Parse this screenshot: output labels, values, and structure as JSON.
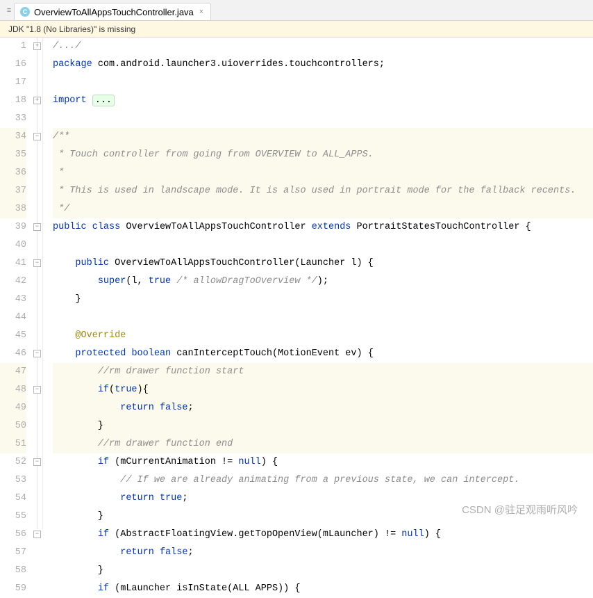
{
  "tab": {
    "icon_letter": "C",
    "filename": "OverviewToAllAppsTouchController.java"
  },
  "notification": {
    "message": "JDK \"1.8 (No Libraries)\" is missing"
  },
  "lines": [
    {
      "n": "1",
      "hl": false,
      "fold": "plus",
      "html": "<span class='cm'>/.../</span>"
    },
    {
      "n": "16",
      "hl": false,
      "fold": "",
      "html": "<span class='kw'>package</span> com.android.launcher3.uioverrides.touchcontrollers;"
    },
    {
      "n": "17",
      "hl": false,
      "fold": "",
      "html": ""
    },
    {
      "n": "18",
      "hl": false,
      "fold": "plus",
      "html": "<span class='kw'>import</span> <span class='folded'>...</span>"
    },
    {
      "n": "33",
      "hl": false,
      "fold": "",
      "html": ""
    },
    {
      "n": "34",
      "hl": true,
      "fold": "minus",
      "html": "<span class='cm'>/**</span>"
    },
    {
      "n": "35",
      "hl": true,
      "fold": "",
      "html": "<span class='cm'> * Touch controller from going from OVERVIEW to ALL_APPS.</span>"
    },
    {
      "n": "36",
      "hl": true,
      "fold": "",
      "html": "<span class='cm'> *</span>"
    },
    {
      "n": "37",
      "hl": true,
      "fold": "",
      "html": "<span class='cm'> * This is used in landscape mode. It is also used in portrait mode for the fallback recents.</span>"
    },
    {
      "n": "38",
      "hl": true,
      "fold": "end",
      "html": "<span class='cm'> */</span>"
    },
    {
      "n": "39",
      "hl": false,
      "fold": "minus",
      "html": "<span class='kw'>public</span> <span class='kw'>class</span> OverviewToAllAppsTouchController <span class='kw'>extends</span> PortraitStatesTouchController {"
    },
    {
      "n": "40",
      "hl": false,
      "fold": "",
      "html": ""
    },
    {
      "n": "41",
      "hl": false,
      "fold": "minus",
      "html": "    <span class='kw'>public</span> OverviewToAllAppsTouchController(Launcher l) {"
    },
    {
      "n": "42",
      "hl": false,
      "fold": "",
      "html": "        <span class='kw'>super</span>(l, <span class='kw'>true</span> <span class='cm'>/* allowDragToOverview */</span>);"
    },
    {
      "n": "43",
      "hl": false,
      "fold": "end",
      "html": "    }"
    },
    {
      "n": "44",
      "hl": false,
      "fold": "",
      "html": ""
    },
    {
      "n": "45",
      "hl": false,
      "fold": "",
      "html": "    <span class='ann'>@Override</span>"
    },
    {
      "n": "46",
      "hl": false,
      "fold": "minus",
      "html": "    <span class='kw'>protected</span> <span class='kw'>boolean</span> canInterceptTouch(MotionEvent ev) {"
    },
    {
      "n": "47",
      "hl": true,
      "fold": "",
      "html": "        <span class='cm'>//rm drawer function start</span>"
    },
    {
      "n": "48",
      "hl": true,
      "fold": "minus",
      "html": "        <span class='kw'>if</span>(<span class='kw'>true</span>){"
    },
    {
      "n": "49",
      "hl": true,
      "fold": "",
      "html": "            <span class='kw'>return</span> <span class='kw'>false</span>;"
    },
    {
      "n": "50",
      "hl": true,
      "fold": "end",
      "html": "        }"
    },
    {
      "n": "51",
      "hl": true,
      "fold": "",
      "html": "        <span class='cm'>//rm drawer function end</span>"
    },
    {
      "n": "52",
      "hl": false,
      "fold": "minus",
      "html": "        <span class='kw'>if</span> (mCurrentAnimation != <span class='kw'>null</span>) {"
    },
    {
      "n": "53",
      "hl": false,
      "fold": "",
      "html": "            <span class='cm'>// If we are already animating from a previous state, we can intercept.</span>"
    },
    {
      "n": "54",
      "hl": false,
      "fold": "",
      "html": "            <span class='kw'>return</span> <span class='kw'>true</span>;"
    },
    {
      "n": "55",
      "hl": false,
      "fold": "end",
      "html": "        }"
    },
    {
      "n": "56",
      "hl": false,
      "fold": "minus",
      "html": "        <span class='kw'>if</span> (AbstractFloatingView.getTopOpenView(mLauncher) != <span class='kw'>null</span>) {"
    },
    {
      "n": "57",
      "hl": false,
      "fold": "",
      "html": "            <span class='kw'>return</span> <span class='kw'>false</span>;"
    },
    {
      "n": "58",
      "hl": false,
      "fold": "end",
      "html": "        }"
    },
    {
      "n": "59",
      "hl": false,
      "fold": "",
      "html": "        <span class='kw'>if</span> (mLauncher isInState(ALL APPS)) {"
    }
  ],
  "watermark": "CSDN @驻足观雨听风吟"
}
